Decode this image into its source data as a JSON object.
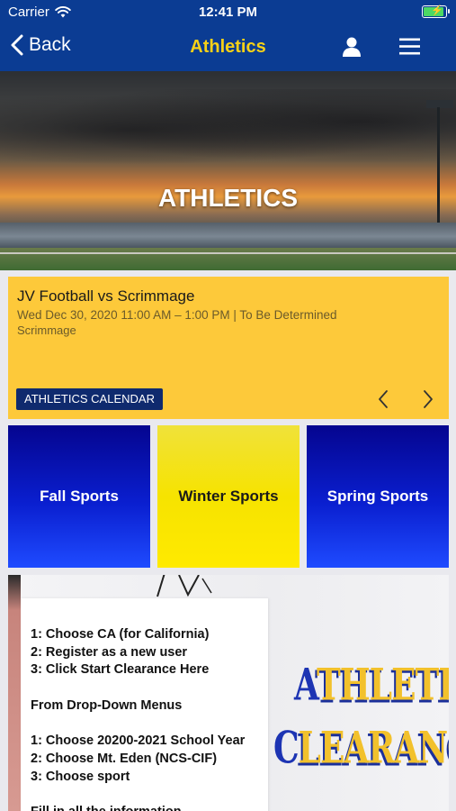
{
  "status_bar": {
    "carrier": "Carrier",
    "time": "12:41 PM"
  },
  "nav": {
    "back_label": "Back",
    "title": "Athletics"
  },
  "hero": {
    "title": "ATHLETICS"
  },
  "event": {
    "title": "JV Football vs Scrimmage",
    "datetime": "Wed Dec 30, 2020 11:00 AM – 1:00 PM  | To Be Determined",
    "location": "Scrimmage",
    "calendar_button": "ATHLETICS CALENDAR"
  },
  "tiles": {
    "fall": "Fall Sports",
    "winter": "Winter Sports",
    "spring": "Spring Sports"
  },
  "clearance": {
    "steps": "1: Choose CA (for California)\n2: Register as a new user\n3: Click Start Clearance Here\n\nFrom Drop-Down Menus\n\n1: Choose 20200-2021 School Year\n2: Choose Mt. Eden (NCS-CIF)\n3: Choose sport\n\nFill in all the information",
    "word1_initial": "A",
    "word1_rest": "THLETIC",
    "word2_initial": "C",
    "word2_rest": "LEARANCE"
  },
  "colors": {
    "nav_bg": "#0b3c93",
    "nav_title": "#f7d117",
    "event_bg": "#fdc93a",
    "calendar_button_bg": "#0f2a6e",
    "tile_blue": "#0a1fd0",
    "tile_yellow": "#f6e300"
  },
  "icons": {
    "wifi": "wifi-icon",
    "battery": "battery-charging-icon",
    "back": "chevron-left-icon",
    "profile": "person-icon",
    "menu": "hamburger-menu-icon",
    "prev": "chevron-left-icon",
    "next": "chevron-right-icon"
  }
}
